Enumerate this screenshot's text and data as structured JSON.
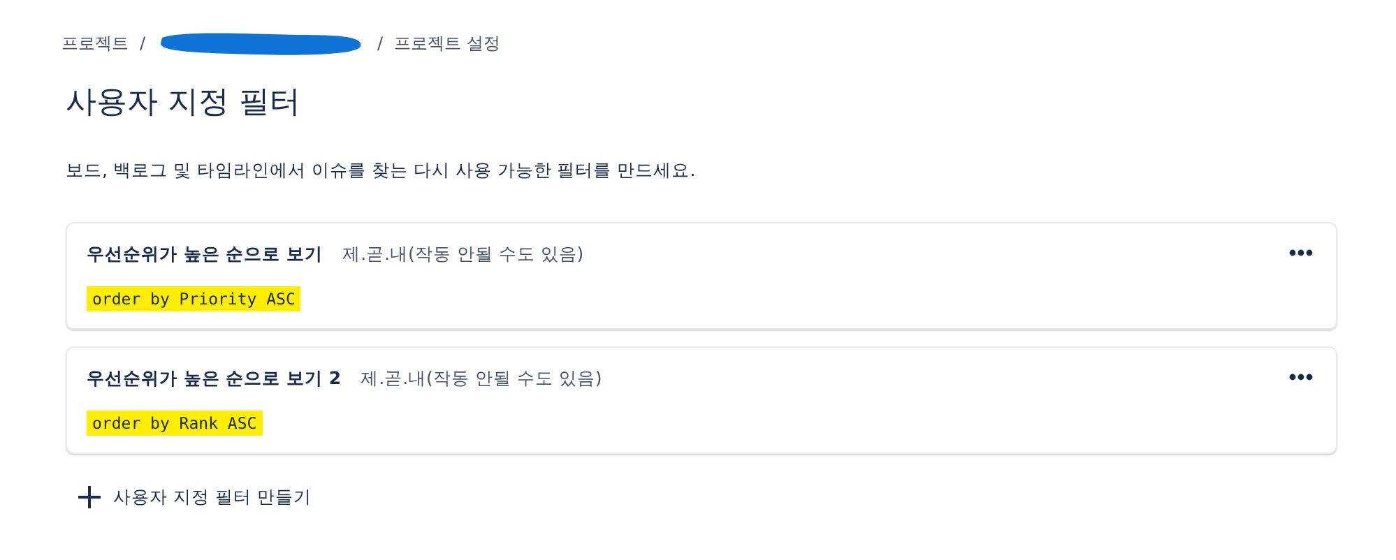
{
  "breadcrumb": {
    "separator": "/",
    "items": [
      {
        "kind": "link",
        "label": "프로젝트"
      },
      {
        "kind": "redacted"
      },
      {
        "kind": "link",
        "label": "프로젝트 설정"
      }
    ]
  },
  "title": "사용자 지정 필터",
  "description": "보드, 백로그 및 타임라인에서 이슈를 찾는 다시 사용 가능한 필터를 만드세요.",
  "filters": [
    {
      "name": "우선순위가 높은 순으로 보기",
      "note": "제.곧.내(작동 안될 수도 있음)",
      "query": "order by Priority ASC",
      "highlighted": true
    },
    {
      "name": "우선순위가 높은 순으로 보기 2",
      "note": "제.곧.내(작동 안될 수도 있음)",
      "query": "order by Rank ASC",
      "highlighted": true
    }
  ],
  "create_button": {
    "label": "사용자 지정 필터 만들기"
  }
}
